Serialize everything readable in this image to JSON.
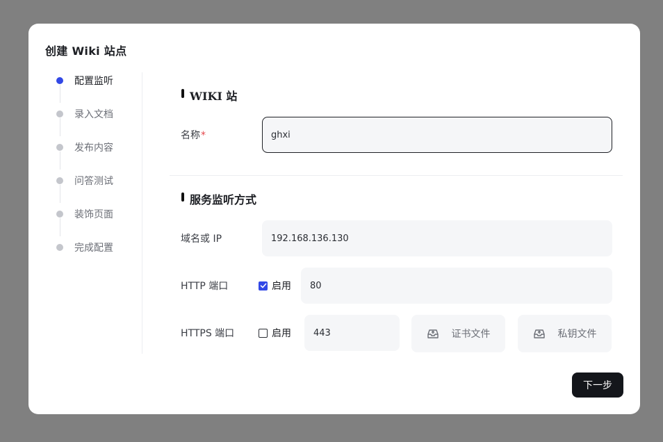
{
  "modal": {
    "title": "创建 Wiki 站点"
  },
  "steps": [
    {
      "label": "配置监听",
      "active": true
    },
    {
      "label": "录入文档",
      "active": false
    },
    {
      "label": "发布内容",
      "active": false
    },
    {
      "label": "问答测试",
      "active": false
    },
    {
      "label": "装饰页面",
      "active": false
    },
    {
      "label": "完成配置",
      "active": false
    }
  ],
  "wiki_section": {
    "title": "WIKI 站",
    "name_label": "名称",
    "name_required_mark": "*",
    "name_value": "ghxi"
  },
  "service_section": {
    "title": "服务监听方式",
    "domain_label": "域名或 IP",
    "domain_value": "192.168.136.130",
    "http_label": "HTTP 端口",
    "http_enabled_label": "启用",
    "http_enabled": true,
    "http_port": "80",
    "https_label": "HTTPS 端口",
    "https_enabled_label": "启用",
    "https_enabled": false,
    "https_port": "443",
    "cert_button": "证书文件",
    "key_button": "私钥文件"
  },
  "footer": {
    "next_label": "下一步"
  },
  "colors": {
    "accent": "#3248e6",
    "primary_button": "#14161b",
    "required": "#e5484d"
  },
  "icons": {
    "upload": "inbox-upload-icon",
    "check": "checkmark-icon"
  }
}
